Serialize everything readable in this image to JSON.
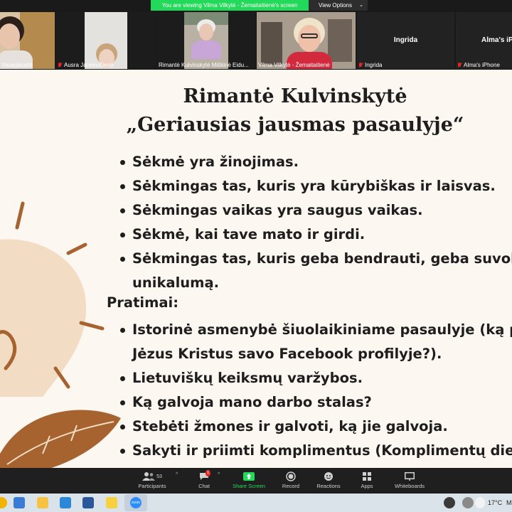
{
  "share_banner": {
    "message": "You are viewing Vilma Vilkytė - Žemaitaitienė's screen",
    "options_label": "View Options",
    "options_chevron": "⌄"
  },
  "participants": [
    {
      "name": "Vasarjanaitė",
      "muted": false
    },
    {
      "name": "Ausra Jankevičienė",
      "muted": true
    },
    {
      "name": "Rimantė Kulvinskytė Miškinė Eidu...",
      "muted": false
    },
    {
      "name": "Vilma Vilkytė - Žemaitaitienė",
      "muted": false,
      "active": true
    },
    {
      "name": "Ingrida",
      "muted": true,
      "video": false
    },
    {
      "name": "Alma's iPhone",
      "muted": true,
      "video": false
    }
  ],
  "slide": {
    "title_line1": "Rimantė Kulvinskytė",
    "title_line2": "„Geriausias jausmas pasaulyje“",
    "bullets_top": [
      "Sėkmė yra žinojimas.",
      "Sėkmingas tas, kuris yra kūrybiškas ir laisvas.",
      "Sėkmingas vaikas yra saugus vaikas.",
      "Sėkmė, kai tave mato ir girdi.",
      "Sėkmingas tas, kuris geba bendrauti, geba suvokti",
      "unikalumą."
    ],
    "section_heading": "Pratimai:",
    "bullets_bottom": [
      "Istorinė asmenybė šiuolaikiniame pasaulyje (ką p",
      "Jėzus Kristus savo Facebook profilyje?).",
      "Lietuviškų keiksmų varžybos.",
      "Ką galvoja mano darbo stalas?",
      "Stebėti žmones ir galvoti, ką jie galvoja.",
      "Sakyti ir priimti komplimentus (Komplimentų die"
    ]
  },
  "toolbar": {
    "participants_label": "Participants",
    "participants_count": "53",
    "chat_label": "Chat",
    "chat_badge": "1",
    "share_label": "Share Screen",
    "record_label": "Record",
    "reactions_label": "Reactions",
    "apps_label": "Apps",
    "whiteboards_label": "Whiteboards",
    "caret": "^"
  },
  "taskbar": {
    "weather": "17°C",
    "weather_suffix": "M",
    "zoom_label": "zoom"
  },
  "colors": {
    "accent_green": "#23d959",
    "slide_bg": "#fdf7f1",
    "active_outline": "#b3d96b",
    "muted_red": "#e02828"
  }
}
